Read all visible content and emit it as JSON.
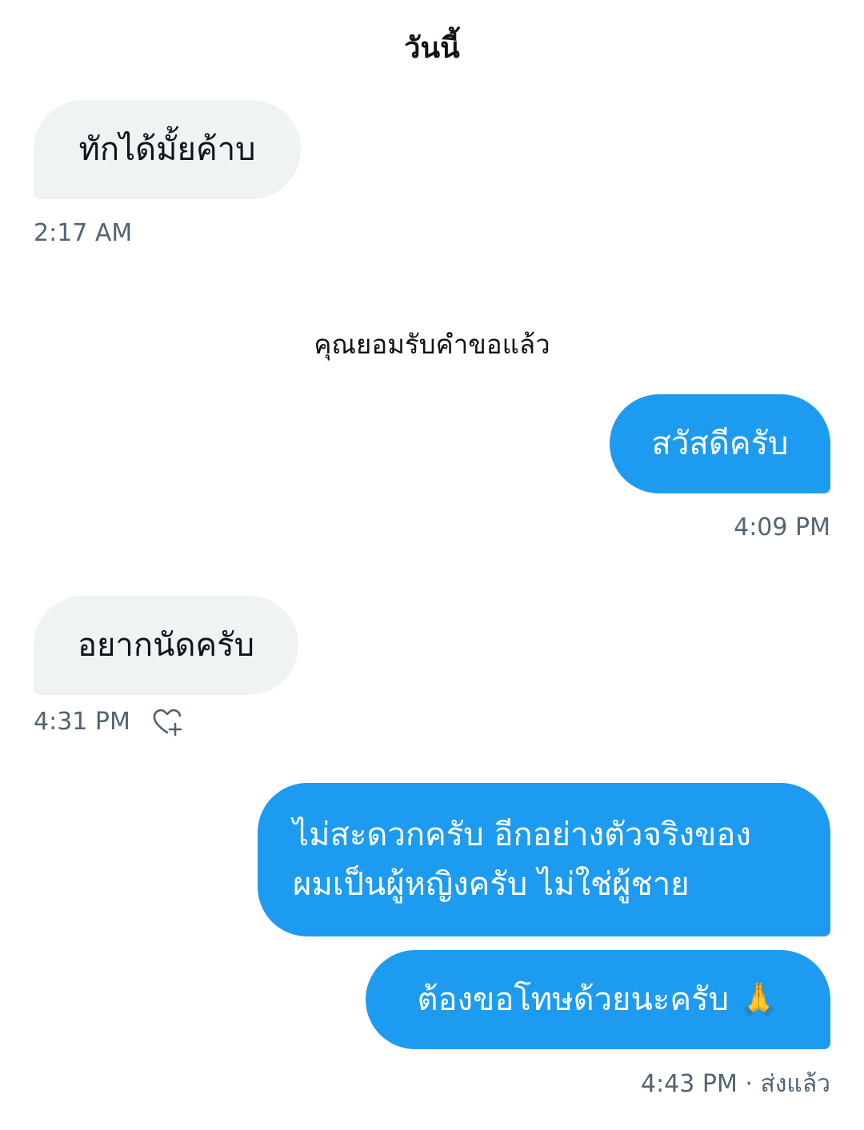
{
  "header": {
    "day_label": "วันนี้"
  },
  "system": {
    "accepted_notice": "คุณยอมรับคำขอแล้ว"
  },
  "messages": [
    {
      "direction": "in",
      "text": "ทักได้มั้ยค้าบ",
      "time": "2:17 AM"
    },
    {
      "direction": "out",
      "text": "สวัสดีครับ",
      "time": "4:09 PM"
    },
    {
      "direction": "in",
      "text": "อยากนัดครับ",
      "time": "4:31 PM",
      "icon": "heart-plus-icon"
    },
    {
      "direction": "out",
      "lines": [
        "ไม่สะดวกครับ อีกอย่างตัวจริงของ",
        "ผมเป็นผู้หญิงครับ ไม่ใช่ผู้ชาย"
      ]
    },
    {
      "direction": "out",
      "text": "ต้องขอโทษด้วยนะครับ 🙏",
      "time": "4:43 PM · ส่งแล้ว"
    }
  ],
  "colors": {
    "outgoing_bubble": "#1d9bf0",
    "incoming_bubble": "#eff3f4",
    "timestamp": "#536471",
    "text": "#0f1419"
  }
}
